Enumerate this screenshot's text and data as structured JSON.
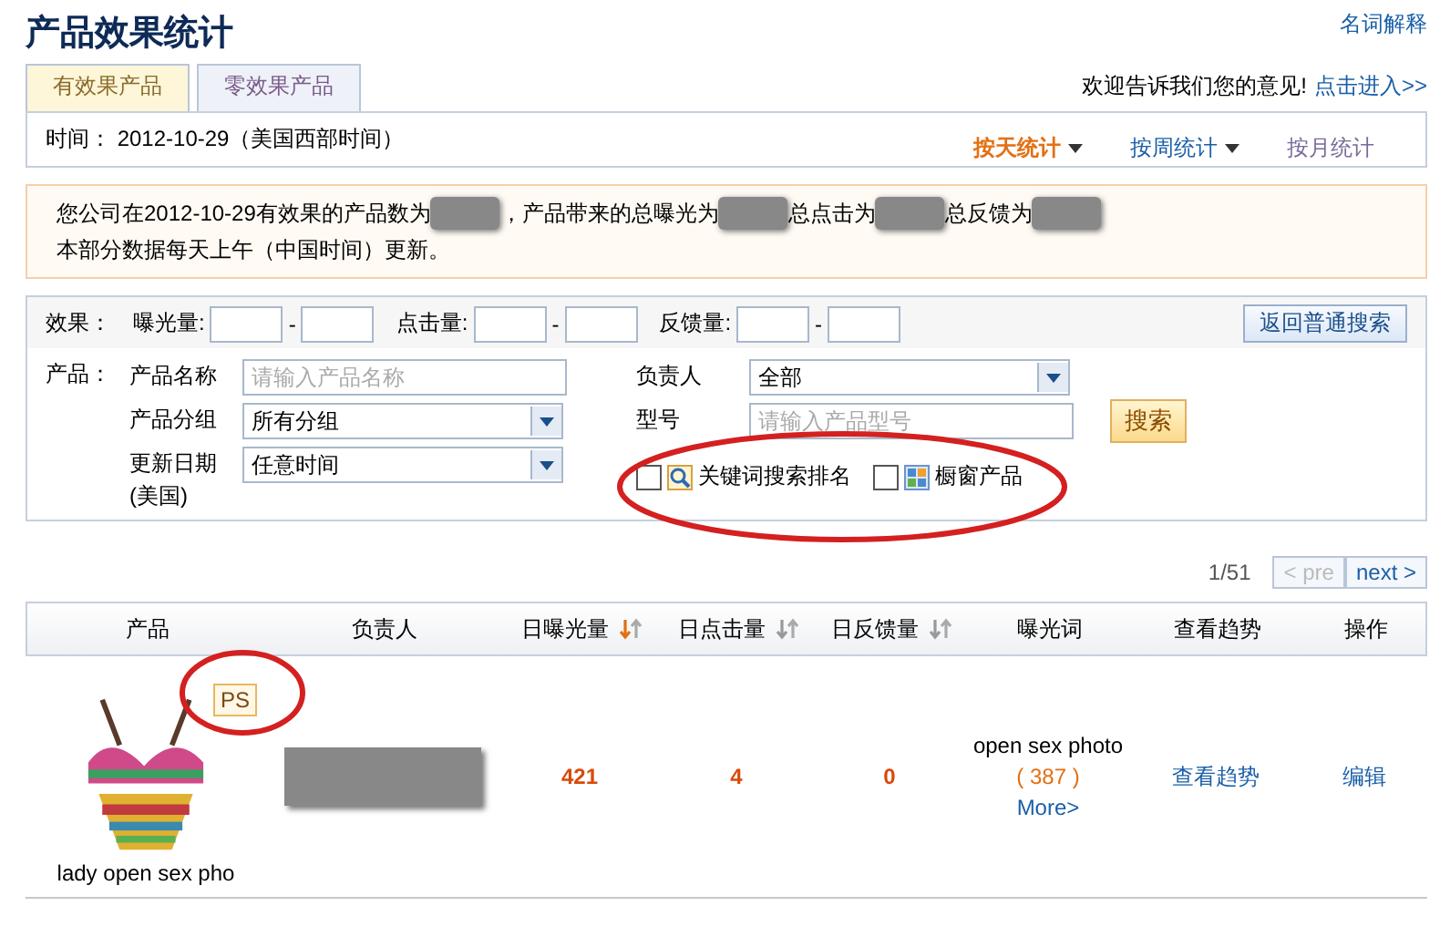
{
  "header": {
    "title": "产品效果统计",
    "help_link": "名词解释"
  },
  "tabs": [
    {
      "label": "有效果产品",
      "selected": true
    },
    {
      "label": "零效果产品",
      "selected": false
    }
  ],
  "feedback": {
    "text": "欢迎告诉我们您的意见!",
    "link": "点击进入>>"
  },
  "time_bar": {
    "text": "时间： 2012-10-29（美国西部时间）",
    "periods": [
      {
        "label": "按天统计",
        "selected": true,
        "dropdown": true
      },
      {
        "label": "按周统计",
        "selected": false,
        "dropdown": true
      },
      {
        "label": "按月统计",
        "selected": false,
        "dropdown": false
      }
    ]
  },
  "summary": {
    "lines": [
      [
        {
          "kind": "text",
          "text": "您公司在2012-10-29有效果的产品数为"
        },
        {
          "kind": "redacted"
        },
        {
          "kind": "text",
          "text": "，产品带来的总曝光为"
        },
        {
          "kind": "redacted"
        },
        {
          "kind": "text",
          "text": "总点击为"
        },
        {
          "kind": "redacted"
        },
        {
          "kind": "text",
          "text": "总反馈为"
        },
        {
          "kind": "redacted"
        }
      ],
      [
        {
          "kind": "text",
          "text": "本部分数据每天上午（中国时间）更新。"
        }
      ]
    ]
  },
  "filters": {
    "effect_label": "效果：",
    "ranges": [
      {
        "label": "曝光量:",
        "separator": "-"
      },
      {
        "label": "点击量:",
        "separator": "-"
      },
      {
        "label": "反馈量:",
        "separator": "-"
      }
    ],
    "back_button": "返回普通搜索",
    "product_label": "产品：",
    "left_fields": [
      {
        "kind": "input",
        "label": [
          "产品名称"
        ],
        "placeholder": "请输入产品名称"
      },
      {
        "kind": "select",
        "label": [
          "产品分组"
        ],
        "value": "所有分组"
      },
      {
        "kind": "select",
        "label": [
          "更新日期",
          "(美国)"
        ],
        "value": "任意时间"
      }
    ],
    "right_fields": [
      {
        "kind": "select",
        "label": [
          "负责人"
        ],
        "value": "全部"
      },
      {
        "kind": "input",
        "label": [
          "型号"
        ],
        "placeholder": "请输入产品型号"
      }
    ],
    "options": {
      "circled": true,
      "items": [
        {
          "label": "关键词搜索排名",
          "checked": false,
          "kind": "keyword"
        },
        {
          "label": "橱窗产品",
          "checked": false,
          "kind": "showcase"
        }
      ]
    },
    "search_button": "搜索"
  },
  "pagination": {
    "page": "1/51",
    "prev": {
      "label": "< pre",
      "disabled": true
    },
    "next": {
      "label": "next >",
      "disabled": false
    }
  },
  "table": {
    "columns": [
      {
        "label": "产品"
      },
      {
        "label": "负责人"
      },
      {
        "label": "日曝光量",
        "sort_active": true
      },
      {
        "label": "日点击量",
        "sort_active": false
      },
      {
        "label": "日反馈量",
        "sort_active": false
      },
      {
        "label": "曝光词"
      },
      {
        "label": "查看趋势"
      },
      {
        "label": "操作"
      }
    ],
    "rows": [
      {
        "product": {
          "name": "lady open sex pho",
          "badge": "PS",
          "badge_circled": true
        },
        "owner_redacted": true,
        "exposures": "421",
        "clicks": "4",
        "feedback": "0",
        "keyword": {
          "text": "open sex photo",
          "count": "( 387 )",
          "more": "More>"
        },
        "trend": "查看趋势",
        "edit": "编辑"
      }
    ]
  }
}
